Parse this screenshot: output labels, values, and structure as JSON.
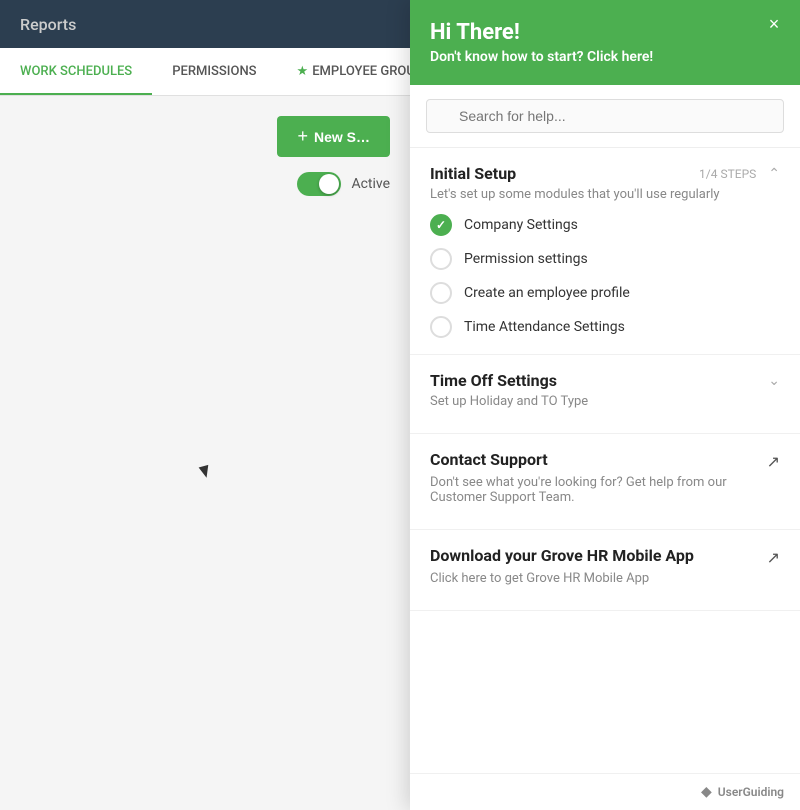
{
  "header": {
    "title": "Reports"
  },
  "tabs": [
    {
      "id": "work-schedules",
      "label": "WORK SCHEDULES",
      "active": true,
      "star": false
    },
    {
      "id": "permissions",
      "label": "PERMISSIONS",
      "active": false,
      "star": false
    },
    {
      "id": "employee-groups",
      "label": "EMPLOYEE GROUPS",
      "active": false,
      "star": true
    }
  ],
  "toolbar": {
    "new_button_label": "+ New S...",
    "new_button_full": "New Schedule",
    "toggle_label": "Active"
  },
  "help_panel": {
    "close_label": "×",
    "header_title": "Hi There!",
    "header_subtitle": "Don't know how to start? Click here!",
    "search_placeholder": "Search for help...",
    "sections": [
      {
        "id": "initial-setup",
        "title": "Initial Setup",
        "desc": "Let's set up some modules that you'll use regularly",
        "steps": "1/4 STEPS",
        "expandable": true,
        "expanded": true,
        "items": [
          {
            "label": "Company Settings",
            "done": true
          },
          {
            "label": "Permission settings",
            "done": false
          },
          {
            "label": "Create an employee profile",
            "done": false
          },
          {
            "label": "Time Attendance Settings",
            "done": false
          }
        ]
      },
      {
        "id": "time-off-settings",
        "title": "Time Off Settings",
        "desc": "Set up Holiday and TO Type",
        "expandable": true,
        "expanded": false,
        "items": []
      },
      {
        "id": "contact-support",
        "title": "Contact Support",
        "desc": "Don't see what you're looking for? Get help from our Customer Support Team.",
        "expandable": false,
        "external": true
      },
      {
        "id": "mobile-app",
        "title": "Download your Grove HR Mobile App",
        "desc": "Click here to get Grove HR Mobile App",
        "expandable": false,
        "external": true
      }
    ]
  },
  "footer": {
    "brand": "UserGuiding"
  },
  "colors": {
    "green": "#4caf50",
    "dark_header": "#2c3e50"
  }
}
